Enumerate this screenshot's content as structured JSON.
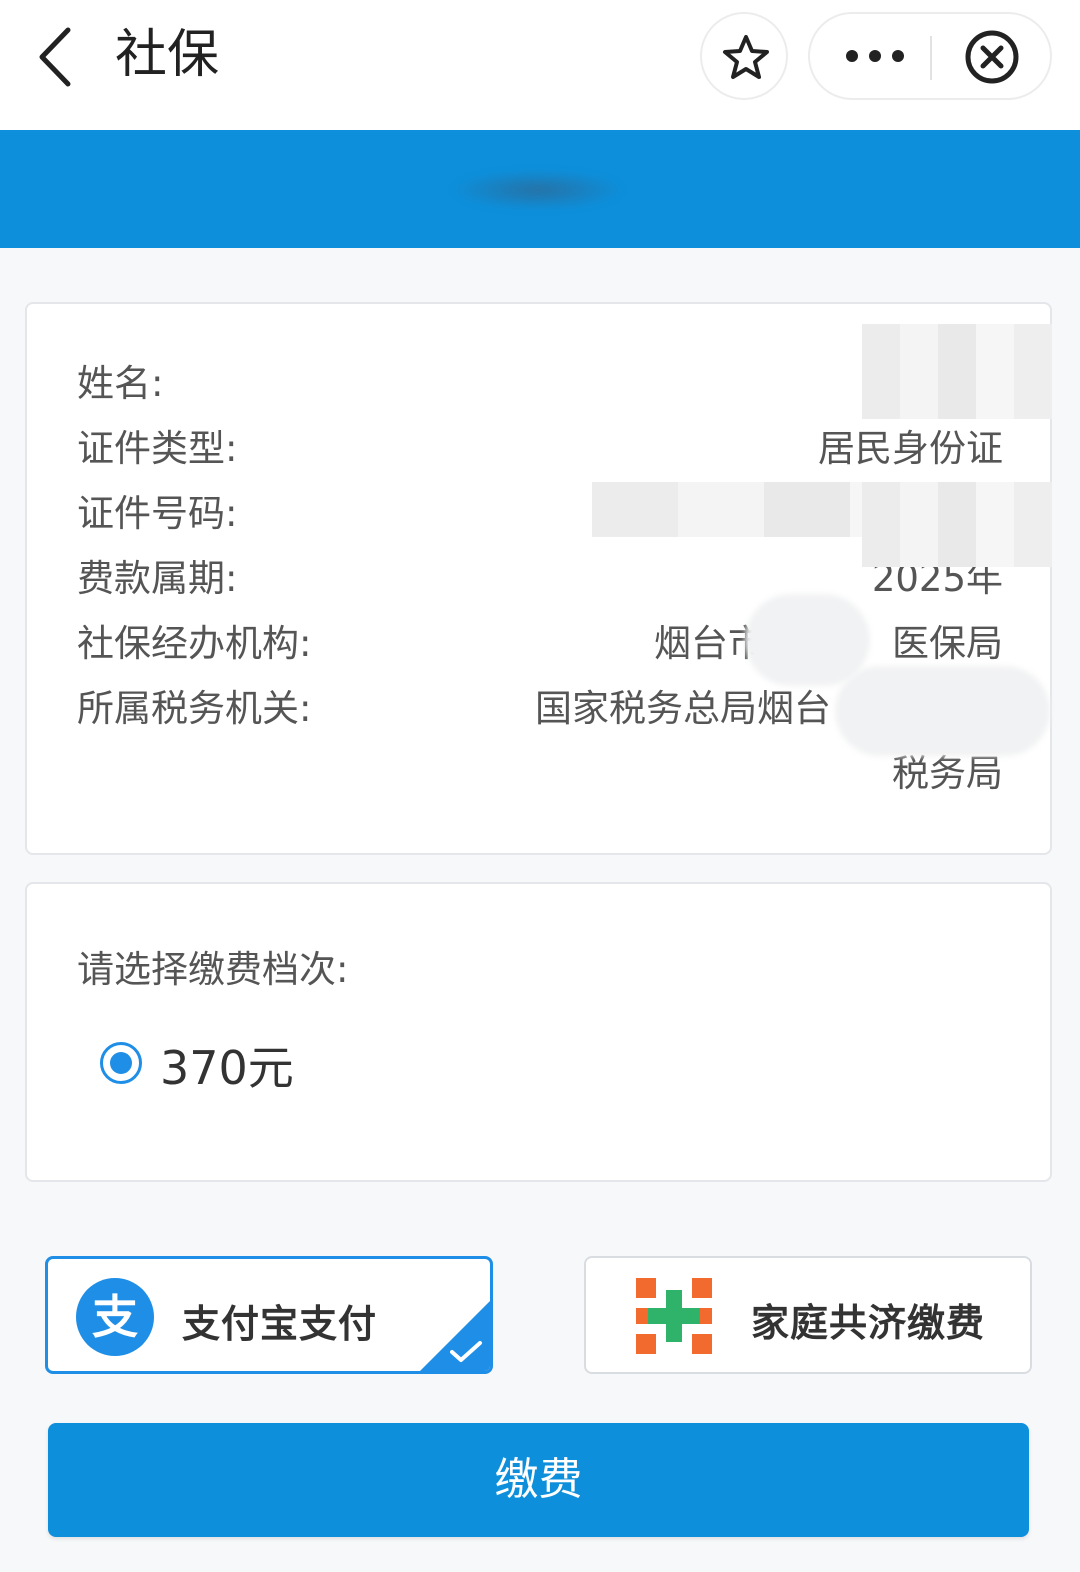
{
  "nav": {
    "title": "社保",
    "icons": {
      "back": "back-chevron-icon",
      "favorite": "star-icon",
      "more": "more-dots-icon",
      "close": "close-circle-icon"
    }
  },
  "info": {
    "rows": [
      {
        "label": "姓名:",
        "value": ""
      },
      {
        "label": "证件类型:",
        "value": "居民身份证"
      },
      {
        "label": "证件号码:",
        "value": ""
      },
      {
        "label": "费款属期:",
        "value": "2025年"
      },
      {
        "label": "社保经办机构:",
        "value": "烟台市",
        "value_suffix": "医保局"
      },
      {
        "label": "所属税务机关:",
        "value": "国家税务总局烟台",
        "value_line2": "税务局"
      }
    ]
  },
  "tier": {
    "title": "请选择缴费档次:",
    "options": [
      {
        "label": "370元",
        "selected": true
      }
    ]
  },
  "payment": {
    "methods": [
      {
        "label": "支付宝支付",
        "icon": "alipay-icon",
        "selected": true
      },
      {
        "label": "家庭共济缴费",
        "icon": "family-cross-icon",
        "selected": false
      }
    ]
  },
  "submit_label": "缴费",
  "colors": {
    "primary": "#0d8fdb",
    "accent": "#1f8ee6",
    "family_orange": "#f26a2e",
    "family_green": "#2fb36b"
  }
}
